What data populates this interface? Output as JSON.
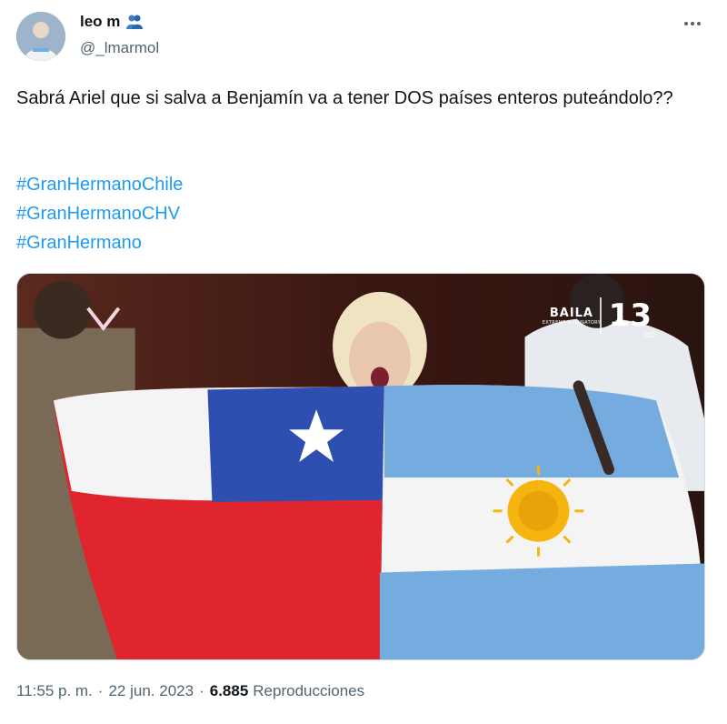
{
  "author": {
    "display_name": "leo m",
    "handle": "@_lmarmol",
    "avatar_icon": "avatar-photo",
    "name_emoji_icon": "people-hugging-icon"
  },
  "tweet": {
    "text": "Sabrá Ariel que si salva a Benjamín va a tener DOS países enteros puteándolo??",
    "hashtags": [
      "#GranHermanoChile",
      "#GranHermanoCHV",
      "#GranHermano"
    ]
  },
  "media": {
    "channel_badge_title": "BAILA",
    "channel_badge_subtitle": "EXTREME ELIMINATORY",
    "channel_number": "13",
    "channel_number_sub": "HD"
  },
  "meta": {
    "time": "11:55 p. m.",
    "separator": "·",
    "date": "22 jun. 2023",
    "views_count": "6.885",
    "views_label": "Reproducciones"
  },
  "colors": {
    "link": "#1d9bf0",
    "secondary_text": "#536471",
    "primary_text": "#0f1419",
    "chile_red": "#e0252f",
    "chile_blue": "#2f4fb0",
    "argentina_blue": "#74acdf",
    "sun_gold": "#f6b40e"
  }
}
